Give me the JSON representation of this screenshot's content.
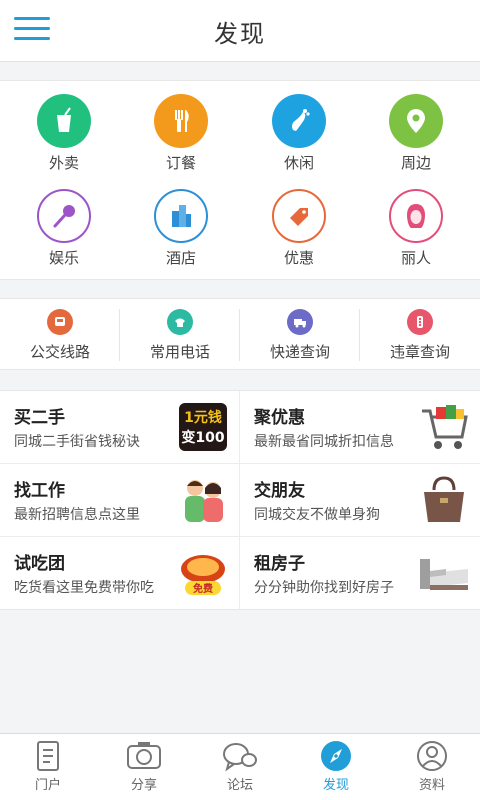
{
  "header": {
    "title": "发现"
  },
  "categories": [
    {
      "label": "外卖",
      "icon": "drink-icon",
      "color": "#22c07f"
    },
    {
      "label": "订餐",
      "icon": "fork-knife-icon",
      "color": "#f39a1c"
    },
    {
      "label": "休闲",
      "icon": "foot-icon",
      "color": "#1fa3e0"
    },
    {
      "label": "周边",
      "icon": "location-pin-icon",
      "color": "#7dc242"
    },
    {
      "label": "娱乐",
      "icon": "microphone-icon",
      "color": "#9b55c6"
    },
    {
      "label": "酒店",
      "icon": "building-icon",
      "color": "#2d8fd6"
    },
    {
      "label": "优惠",
      "icon": "tag-icon",
      "color": "#e7683a"
    },
    {
      "label": "丽人",
      "icon": "woman-icon",
      "color": "#e24e7a"
    }
  ],
  "utilities": [
    {
      "label": "公交线路",
      "icon": "bus-icon",
      "color": "#e46a3d"
    },
    {
      "label": "常用电话",
      "icon": "phone-icon",
      "color": "#2dbaa3"
    },
    {
      "label": "快递查询",
      "icon": "truck-icon",
      "color": "#6c6bc8"
    },
    {
      "label": "违章查询",
      "icon": "traffic-light-icon",
      "color": "#e7566a"
    }
  ],
  "services": [
    {
      "title": "买二手",
      "subtitle": "同城二手街省钱秘诀",
      "image": "one-yuan-100-badge-image",
      "badge_line1": "1元钱",
      "badge_line2": "变100"
    },
    {
      "title": "聚优惠",
      "subtitle": "最新最省同城折扣信息",
      "image": "shopping-cart-image"
    },
    {
      "title": "找工作",
      "subtitle": "最新招聘信息点这里",
      "image": "couple-image"
    },
    {
      "title": "交朋友",
      "subtitle": "同城交友不做单身狗",
      "image": "handbag-image"
    },
    {
      "title": "试吃团",
      "subtitle": "吃货看这里免费带你吃",
      "image": "free-food-image",
      "badge": "免费"
    },
    {
      "title": "租房子",
      "subtitle": "分分钟助你找到好房子",
      "image": "bed-image"
    }
  ],
  "tabs": [
    {
      "label": "门户",
      "icon": "document-icon"
    },
    {
      "label": "分享",
      "icon": "camera-icon"
    },
    {
      "label": "论坛",
      "icon": "chat-bubbles-icon"
    },
    {
      "label": "发现",
      "icon": "compass-icon",
      "active": true
    },
    {
      "label": "资料",
      "icon": "profile-icon"
    }
  ],
  "colors": {
    "accent": "#1f9ed8"
  }
}
